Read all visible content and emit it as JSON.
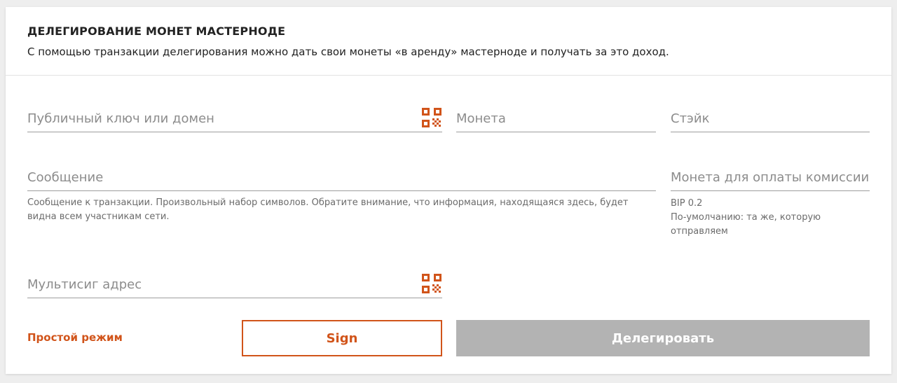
{
  "header": {
    "title": "ДЕЛЕГИРОВАНИЕ МОНЕТ МАСТЕРНОДЕ",
    "description": "С помощью транзакции делегирования можно дать свои монеты «в аренду» мастерноде и получать за это доход."
  },
  "form": {
    "public_key_placeholder": "Публичный ключ или домен",
    "coin_placeholder": "Монета",
    "stake_placeholder": "Стэйк",
    "message_placeholder": "Сообщение",
    "message_hint": "Сообщение к транзакции. Произвольный набор символов. Обратите внимание, что информация, находящаяся здесь, будет видна всем участникам сети.",
    "fee_coin_placeholder": "Монета для оплаты комиссии",
    "fee_coin_hint_line1": "BIP 0.2",
    "fee_coin_hint_line2": "По-умолчанию: та же, которую отправляем",
    "multisig_placeholder": "Мультисиг адрес"
  },
  "actions": {
    "simple_mode_label": "Простой режим",
    "sign_label": "Sign",
    "delegate_label": "Делегировать"
  },
  "colors": {
    "accent": "#d1541a",
    "disabled_button": "#b3b3b3"
  },
  "icons": {
    "qr": "qr-code-icon"
  }
}
